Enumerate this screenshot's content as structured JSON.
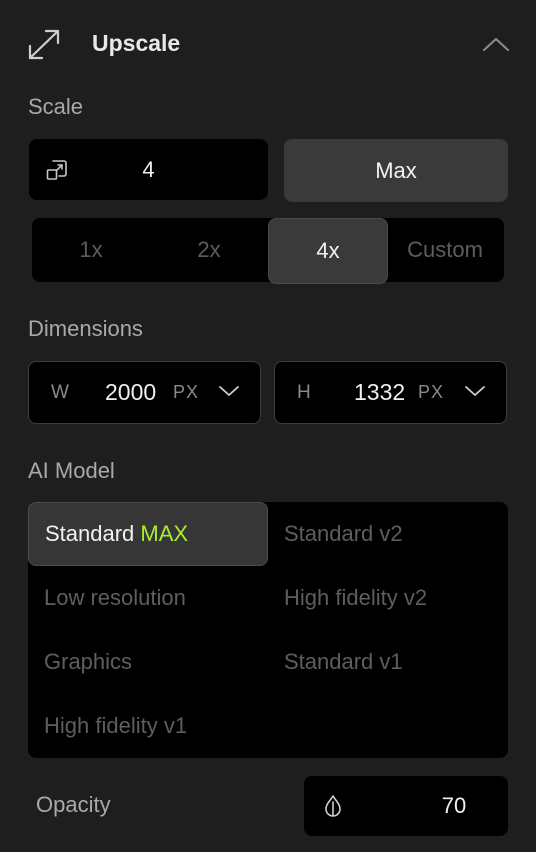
{
  "header": {
    "title": "Upscale",
    "icon": "expand-arrows-icon",
    "collapse_icon": "chevron-up-icon"
  },
  "scale": {
    "label": "Scale",
    "input_value": "4",
    "input_icon": "scale-icon",
    "max_label": "Max",
    "options": [
      "1x",
      "2x",
      "4x",
      "Custom"
    ],
    "selected": "4x"
  },
  "dimensions": {
    "label": "Dimensions",
    "width": {
      "prefix": "W",
      "value": "2000",
      "unit": "PX"
    },
    "height": {
      "prefix": "H",
      "value": "1332",
      "unit": "PX"
    }
  },
  "ai_model": {
    "label": "AI Model",
    "selected": "Standard MAX",
    "options": [
      {
        "name": "Standard",
        "highlight": "MAX"
      },
      {
        "name": "Standard v2",
        "highlight": ""
      },
      {
        "name": "Low resolution",
        "highlight": ""
      },
      {
        "name": "High fidelity v2",
        "highlight": ""
      },
      {
        "name": "Graphics",
        "highlight": ""
      },
      {
        "name": "Standard v1",
        "highlight": ""
      },
      {
        "name": "High fidelity v1",
        "highlight": ""
      }
    ],
    "highlight_color": "#a6ef2e"
  },
  "opacity": {
    "label": "Opacity",
    "value": "70",
    "icon": "drop-icon"
  }
}
